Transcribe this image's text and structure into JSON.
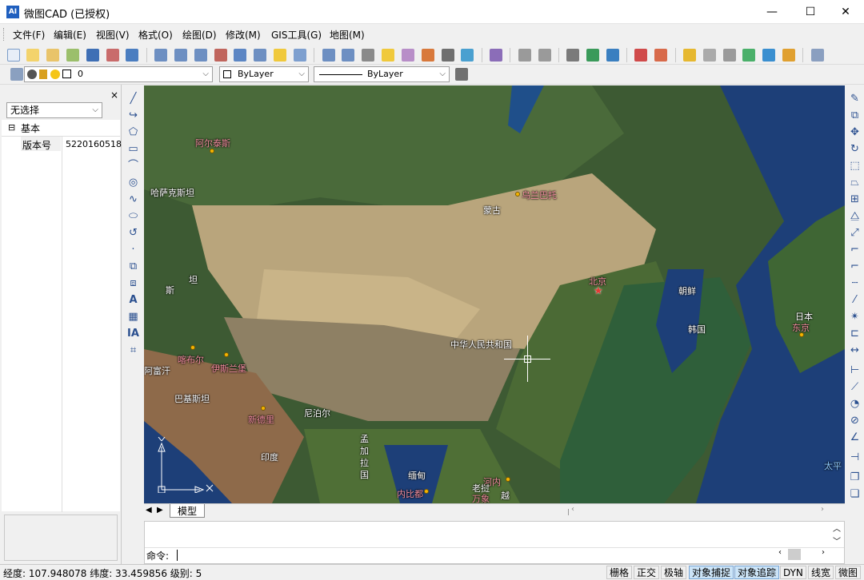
{
  "window": {
    "title": "微图CAD (已授权)",
    "icon_text": "AI",
    "minimize": "—",
    "maximize": "☐",
    "close": "✕"
  },
  "menu": [
    "文件(F)",
    "编辑(E)",
    "视图(V)",
    "格式(O)",
    "绘图(D)",
    "修改(M)",
    "GIS工具(G)",
    "地图(M)"
  ],
  "layer_bar": {
    "layer_value": "0",
    "color_value": "ByLayer",
    "linetype_value": "ByLayer"
  },
  "properties": {
    "selection": "无选择",
    "section": "基本",
    "rows": [
      {
        "key": "版本号",
        "value": "5220160518"
      }
    ]
  },
  "map_labels": [
    {
      "text": "阿尔泰斯",
      "pink": true
    },
    {
      "text": "哈萨克斯坦",
      "pink": false
    },
    {
      "text": "乌兰巴托",
      "pink": true
    },
    {
      "text": "蒙古",
      "pink": false
    },
    {
      "text": "北京",
      "pink": true
    },
    {
      "text": "朝鲜",
      "pink": false
    },
    {
      "text": "韩国",
      "pink": false
    },
    {
      "text": "日本",
      "pink": false
    },
    {
      "text": "东京",
      "pink": true
    },
    {
      "text": "中华人民共和国",
      "pink": false
    },
    {
      "text": "斯",
      "pink": false
    },
    {
      "text": "坦",
      "pink": false
    },
    {
      "text": "阿富汗",
      "pink": false
    },
    {
      "text": "伊斯兰堡",
      "pink": true
    },
    {
      "text": "喀布尔",
      "pink": true
    },
    {
      "text": "巴基斯坦",
      "pink": false
    },
    {
      "text": "新德里",
      "pink": true
    },
    {
      "text": "尼泊尔",
      "pink": false
    },
    {
      "text": "印度",
      "pink": false
    },
    {
      "text": "孟加拉国",
      "pink": false
    },
    {
      "text": "缅甸",
      "pink": false
    },
    {
      "text": "内比都",
      "pink": true
    },
    {
      "text": "河内",
      "pink": true
    },
    {
      "text": "老挝",
      "pink": false
    },
    {
      "text": "万象",
      "pink": true
    },
    {
      "text": "越",
      "pink": false
    },
    {
      "text": "太平",
      "pink": false
    }
  ],
  "tabs": {
    "model": "模型"
  },
  "command": {
    "prompt": "命令:"
  },
  "status": {
    "coords": "经度: 107.948078 纬度: 33.459856 级别: 5",
    "buttons": [
      {
        "label": "栅格",
        "on": false
      },
      {
        "label": "正交",
        "on": false
      },
      {
        "label": "极轴",
        "on": false
      },
      {
        "label": "对象捕捉",
        "on": true
      },
      {
        "label": "对象追踪",
        "on": true
      },
      {
        "label": "DYN",
        "on": false
      },
      {
        "label": "线宽",
        "on": false
      },
      {
        "label": "微图",
        "on": false
      }
    ]
  },
  "colors": {
    "accent": "#1f5fbf",
    "status_on": "#cce4f7",
    "map_pink_label": "#f48fa0"
  }
}
